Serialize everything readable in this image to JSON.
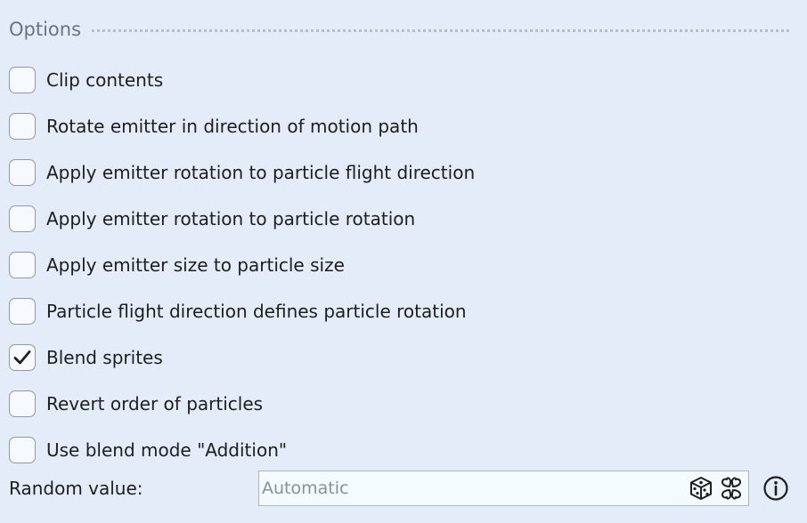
{
  "section": {
    "title": "Options"
  },
  "options": [
    {
      "label": "Clip contents",
      "checked": false
    },
    {
      "label": "Rotate emitter in direction of motion path",
      "checked": false
    },
    {
      "label": "Apply emitter rotation to particle flight direction",
      "checked": false
    },
    {
      "label": "Apply emitter rotation to particle rotation",
      "checked": false
    },
    {
      "label": "Apply emitter size to particle size",
      "checked": false
    },
    {
      "label": "Particle flight direction defines particle rotation",
      "checked": false
    },
    {
      "label": "Blend sprites",
      "checked": true
    },
    {
      "label": "Revert order of particles",
      "checked": false
    },
    {
      "label": "Use blend mode \"Addition\"",
      "checked": false
    }
  ],
  "random_value": {
    "label": "Random value:",
    "value": "",
    "placeholder": "Automatic",
    "icons": [
      "dice-icon",
      "clover-icon",
      "info-icon"
    ]
  },
  "colors": {
    "background": "#e3ecf8",
    "header_text": "#6b7480",
    "checkbox_border": "#8f9aa6"
  }
}
